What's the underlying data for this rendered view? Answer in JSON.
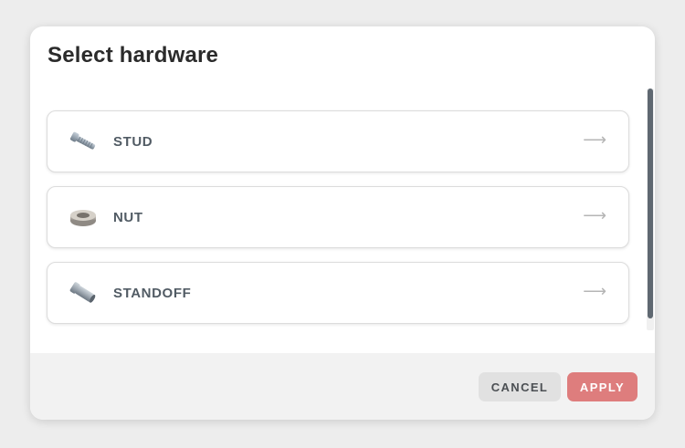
{
  "dialog": {
    "title": "Select hardware",
    "items": [
      {
        "label": "STUD",
        "icon": "stud-icon",
        "arrow": "⟶"
      },
      {
        "label": "NUT",
        "icon": "nut-icon",
        "arrow": "⟶"
      },
      {
        "label": "STANDOFF",
        "icon": "standoff-icon",
        "arrow": "⟶"
      }
    ],
    "cancel_label": "CANCEL",
    "apply_label": "APPLY"
  },
  "colors": {
    "accent": "#de7d7d",
    "label": "#515b64",
    "scrollbar": "#5f6871"
  }
}
